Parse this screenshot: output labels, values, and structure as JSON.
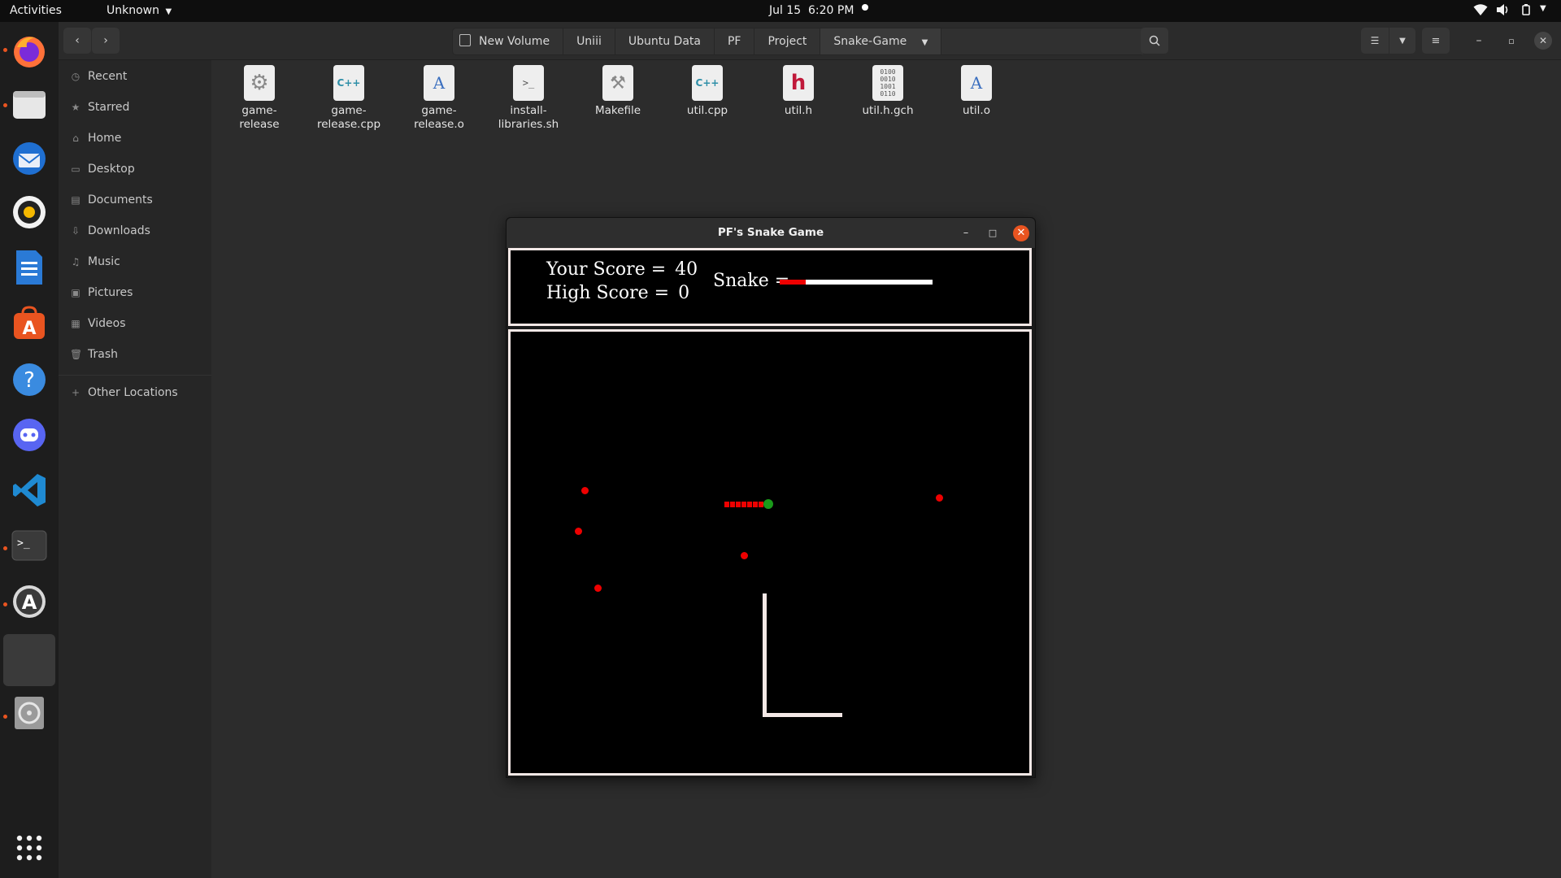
{
  "topbar": {
    "activities": "Activities",
    "app_menu": "Unknown",
    "date": "Jul 15",
    "time": "6:20 PM"
  },
  "dock": {
    "icons": [
      "firefox-icon",
      "files-icon",
      "thunderbird-icon",
      "rhythmbox-icon",
      "writer-icon",
      "app-center-icon",
      "help-icon",
      "discord-icon",
      "vscode-icon",
      "terminal-icon",
      "software-updater-icon",
      "active-window-icon",
      "disk-icon",
      "show-apps-icon"
    ]
  },
  "files_window": {
    "path": [
      "New Volume",
      "Uniii",
      "Ubuntu Data",
      "PF",
      "Project",
      "Snake-Game"
    ],
    "sidebar": [
      {
        "label": "Recent",
        "icon": "clock-icon"
      },
      {
        "label": "Starred",
        "icon": "star-icon"
      },
      {
        "label": "Home",
        "icon": "home-icon"
      },
      {
        "label": "Desktop",
        "icon": "desktop-icon"
      },
      {
        "label": "Documents",
        "icon": "document-icon"
      },
      {
        "label": "Downloads",
        "icon": "download-icon"
      },
      {
        "label": "Music",
        "icon": "music-icon"
      },
      {
        "label": "Pictures",
        "icon": "picture-icon"
      },
      {
        "label": "Videos",
        "icon": "video-icon"
      },
      {
        "label": "Trash",
        "icon": "trash-icon"
      },
      {
        "label": "Other Locations",
        "icon": "plus-icon"
      }
    ],
    "files": [
      {
        "name": "game-\nrelease",
        "kind": "executable",
        "glyph": "⚙"
      },
      {
        "name": "game-\nrelease.cpp",
        "kind": "cpp",
        "glyph": "C++"
      },
      {
        "name": "game-\nrelease.o",
        "kind": "object",
        "glyph": "A"
      },
      {
        "name": "install-\nlibraries.sh",
        "kind": "script",
        "glyph": ">_"
      },
      {
        "name": "Makefile",
        "kind": "makefile",
        "glyph": "⚒"
      },
      {
        "name": "util.cpp",
        "kind": "cpp",
        "glyph": "C++"
      },
      {
        "name": "util.h",
        "kind": "header",
        "glyph": "h"
      },
      {
        "name": "util.h.gch",
        "kind": "binary",
        "glyph": "0100"
      },
      {
        "name": "util.o",
        "kind": "object",
        "glyph": "A"
      }
    ]
  },
  "game_window": {
    "title": "PF's Snake Game",
    "score_label": "Your Score =",
    "score_value": "40",
    "high_score_label": "High Score =",
    "high_score_value": "0",
    "snake_label": "Snake =",
    "snake_bar_fraction": 0.17,
    "colors": {
      "snake_body": "#ee0000",
      "snake_head": "#1a9a1a",
      "food": "#ee0000",
      "wall": "#f4e8e6"
    }
  }
}
